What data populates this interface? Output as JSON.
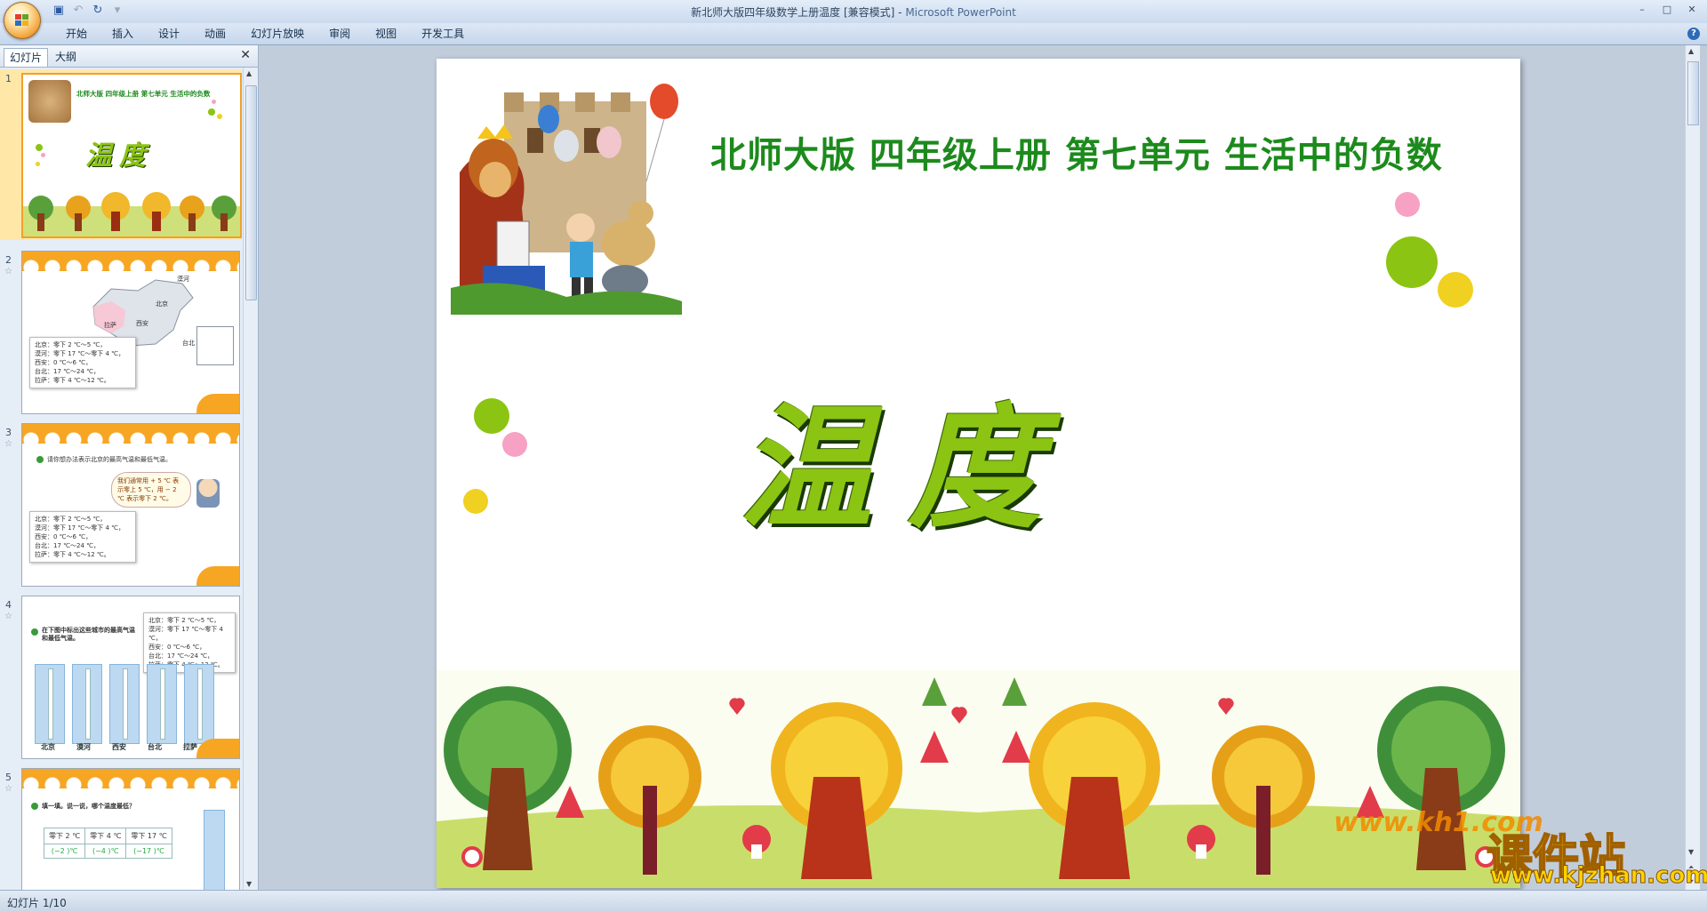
{
  "window": {
    "title": "新北师大版四年级数学上册温度 [兼容模式] -",
    "app_name": "Microsoft PowerPoint",
    "controls": [
      "–",
      "□",
      "✕"
    ]
  },
  "quick_access": [
    "save-icon",
    "undo-icon",
    "redo-icon",
    "customize-icon"
  ],
  "ribbon": {
    "tabs": [
      "开始",
      "插入",
      "设计",
      "动画",
      "幻灯片放映",
      "审阅",
      "视图",
      "开发工具"
    ],
    "help": "?"
  },
  "left_panel": {
    "tabs": [
      "幻灯片",
      "大纲"
    ],
    "close": "✕",
    "slides": [
      {
        "number": "1",
        "title": "北师大版 四年级上册 第七单元 生活中的负数",
        "big": "温度"
      },
      {
        "number": "2",
        "map_labels": [
          "漠河",
          "北京",
          "西安",
          "拉萨",
          "台北"
        ],
        "note": "北京：零下 2 ℃～5 ℃，\n漠河：零下 17 ℃～零下 4 ℃，\n西安：0 ℃～6 ℃，\n台北：17 ℃～24 ℃，\n拉萨：零下 4 ℃～12 ℃。"
      },
      {
        "number": "3",
        "prompt": "请你想办法表示北京的最高气温和最低气温。",
        "bubble": "我们通常用 + 5 ℃ 表示零上 5 ℃，用 − 2 ℃ 表示零下 2 ℃。",
        "note": "北京：零下 2 ℃～5 ℃，\n漠河：零下 17 ℃～零下 4 ℃，\n西安：0 ℃～6 ℃，\n台北：17 ℃～24 ℃，\n拉萨：零下 4 ℃～12 ℃。"
      },
      {
        "number": "4",
        "prompt": "在下图中标出这些城市的最高气温和最低气温。",
        "cities": [
          "北京",
          "漠河",
          "西安",
          "台北",
          "拉萨"
        ],
        "note": "北京：零下 2 ℃～5 ℃，\n漠河：零下 17 ℃～零下 4 ℃，\n西安：0 ℃～6 ℃，\n台北：17 ℃～24 ℃，\n拉萨：零下 4 ℃～12 ℃。"
      },
      {
        "number": "5",
        "prompt": "填一填。说一说，哪个温度最低？",
        "table_head": [
          "零下 2 ℃",
          "零下 4 ℃",
          "零下 17 ℃"
        ],
        "table_vals": [
          "(−2 )℃",
          "(−4 )℃",
          "(−17 )℃"
        ]
      }
    ]
  },
  "slide": {
    "title": "北师大版  四年级上册  第七单元  生活中的负数",
    "big_title": "温度",
    "dot_colors": {
      "pink": "#f7a1c4",
      "green": "#8cc413",
      "yellow": "#f0d020"
    }
  },
  "watermark": {
    "site_cn": "课件站",
    "site_url": "www.kjzhan.com",
    "site_small": "www.kh1.com"
  },
  "status_bar": {
    "slide_indicator": "幻灯片 1/10"
  }
}
